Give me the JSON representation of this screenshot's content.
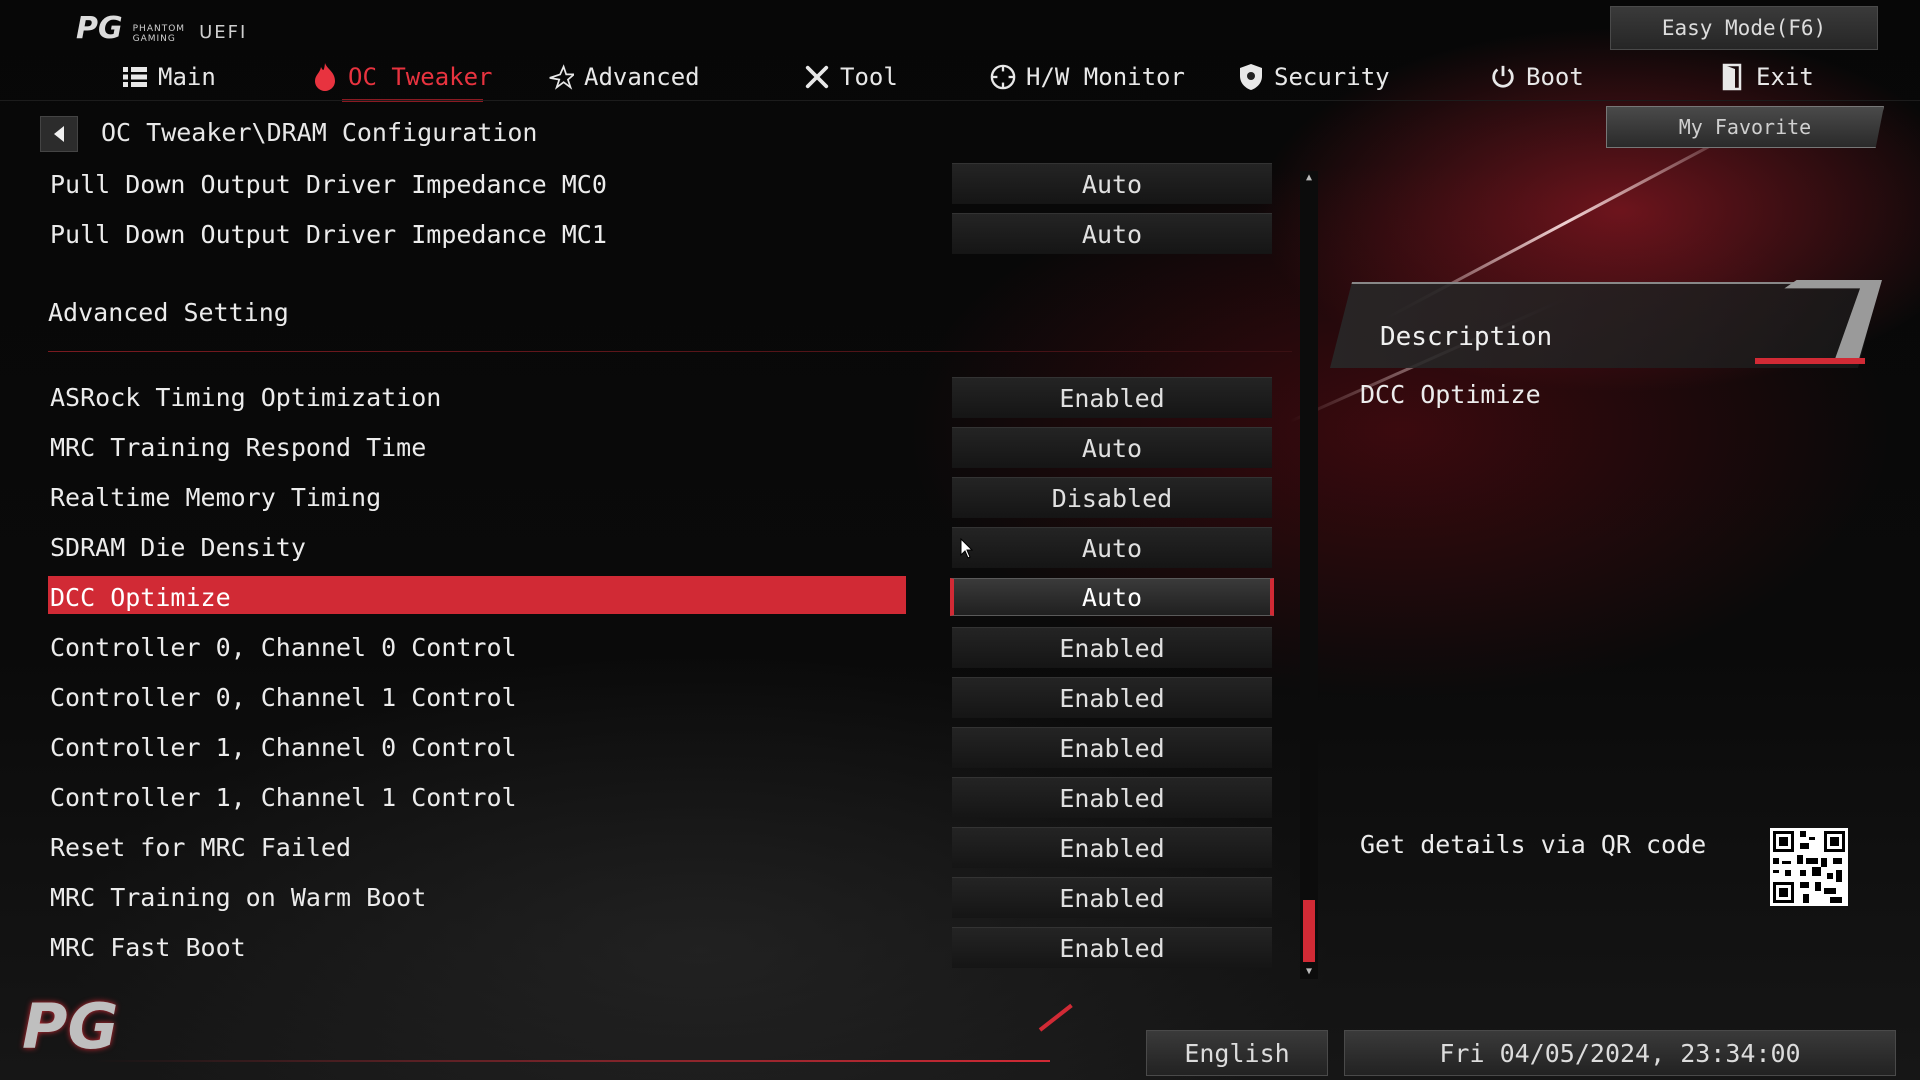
{
  "header": {
    "brand_line1": "PHANTOM",
    "brand_line2": "GAMING",
    "brand_uefi": "UEFI",
    "easy_mode_label": "Easy Mode(F6)"
  },
  "nav": {
    "items": [
      {
        "label": "Main",
        "icon": "list-icon"
      },
      {
        "label": "OC Tweaker",
        "icon": "flame-icon"
      },
      {
        "label": "Advanced",
        "icon": "star-icon"
      },
      {
        "label": "Tool",
        "icon": "wrench-screwdriver-icon"
      },
      {
        "label": "H/W Monitor",
        "icon": "monitor-dial-icon"
      },
      {
        "label": "Security",
        "icon": "shield-icon"
      },
      {
        "label": "Boot",
        "icon": "power-icon"
      },
      {
        "label": "Exit",
        "icon": "exit-door-icon"
      }
    ],
    "active_index": 1
  },
  "breadcrumb": "OC Tweaker\\DRAM Configuration",
  "my_favorite_label": "My Favorite",
  "settings_top": [
    {
      "label": "Pull Down Output Driver Impedance MC0",
      "value": "Auto"
    },
    {
      "label": "Pull Down Output Driver Impedance MC1",
      "value": "Auto"
    }
  ],
  "section_title": "Advanced Setting",
  "settings": [
    {
      "label": "ASRock Timing Optimization",
      "value": "Enabled"
    },
    {
      "label": "MRC Training Respond Time",
      "value": "Auto"
    },
    {
      "label": "Realtime Memory Timing",
      "value": "Disabled"
    },
    {
      "label": "SDRAM Die Density",
      "value": "Auto"
    },
    {
      "label": "DCC Optimize",
      "value": "Auto",
      "selected": true
    },
    {
      "label": "Controller 0, Channel 0 Control",
      "value": "Enabled"
    },
    {
      "label": "Controller 0, Channel 1 Control",
      "value": "Enabled"
    },
    {
      "label": "Controller 1, Channel 0 Control",
      "value": "Enabled"
    },
    {
      "label": "Controller 1, Channel 1 Control",
      "value": "Enabled"
    },
    {
      "label": "Reset for MRC Failed",
      "value": "Enabled"
    },
    {
      "label": "MRC Training on Warm Boot",
      "value": "Enabled"
    },
    {
      "label": "MRC Fast Boot",
      "value": "Enabled"
    }
  ],
  "description": {
    "title": "Description",
    "text": "DCC Optimize",
    "qr_label": "Get details via QR code"
  },
  "footer": {
    "language": "English",
    "datetime": "Fri 04/05/2024, 23:34:00"
  },
  "colors": {
    "accent_red": "#d12a35",
    "background": "#050505"
  }
}
